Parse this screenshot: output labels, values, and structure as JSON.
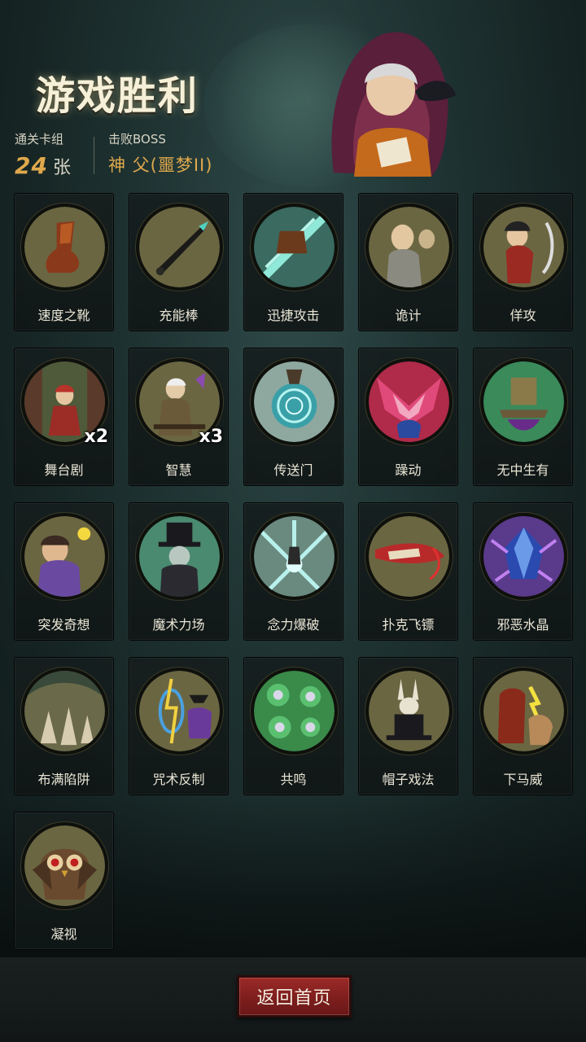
{
  "header": {
    "title": "游戏胜利",
    "deck": {
      "label": "通关卡组",
      "value": "24",
      "unit": "张"
    },
    "boss": {
      "label": "击败BOSS",
      "value": "神 父(噩梦II)"
    }
  },
  "cards": [
    {
      "name": "速度之靴",
      "icon": "boot-icon",
      "count": ""
    },
    {
      "name": "充能棒",
      "icon": "wand-icon",
      "count": ""
    },
    {
      "name": "迅捷攻击",
      "icon": "axe-strike-icon",
      "count": ""
    },
    {
      "name": "诡计",
      "icon": "trickster-icon",
      "count": ""
    },
    {
      "name": "佯攻",
      "icon": "feint-icon",
      "count": ""
    },
    {
      "name": "舞台剧",
      "icon": "stage-play-icon",
      "count": "x2"
    },
    {
      "name": "智慧",
      "icon": "wisdom-icon",
      "count": "x3"
    },
    {
      "name": "传送门",
      "icon": "portal-icon",
      "count": ""
    },
    {
      "name": "躁动",
      "icon": "frenzy-icon",
      "count": ""
    },
    {
      "name": "无中生有",
      "icon": "conjure-icon",
      "count": ""
    },
    {
      "name": "突发奇想",
      "icon": "idea-icon",
      "count": ""
    },
    {
      "name": "魔术力场",
      "icon": "magician-icon",
      "count": ""
    },
    {
      "name": "念力爆破",
      "icon": "telekinesis-icon",
      "count": ""
    },
    {
      "name": "扑克飞镖",
      "icon": "card-dart-icon",
      "count": ""
    },
    {
      "name": "邪恶水晶",
      "icon": "crystal-icon",
      "count": ""
    },
    {
      "name": "布满陷阱",
      "icon": "trap-icon",
      "count": ""
    },
    {
      "name": "咒术反制",
      "icon": "counterspell-icon",
      "count": ""
    },
    {
      "name": "共鸣",
      "icon": "resonance-icon",
      "count": ""
    },
    {
      "name": "帽子戏法",
      "icon": "hat-trick-icon",
      "count": ""
    },
    {
      "name": "下马威",
      "icon": "intimidate-icon",
      "count": ""
    },
    {
      "name": "凝视",
      "icon": "owl-gaze-icon",
      "count": ""
    }
  ],
  "footer": {
    "home_label": "返回首页"
  },
  "colors": {
    "accent": "#e0a84c",
    "button": "#8a2423",
    "medal": "#6b6642"
  }
}
